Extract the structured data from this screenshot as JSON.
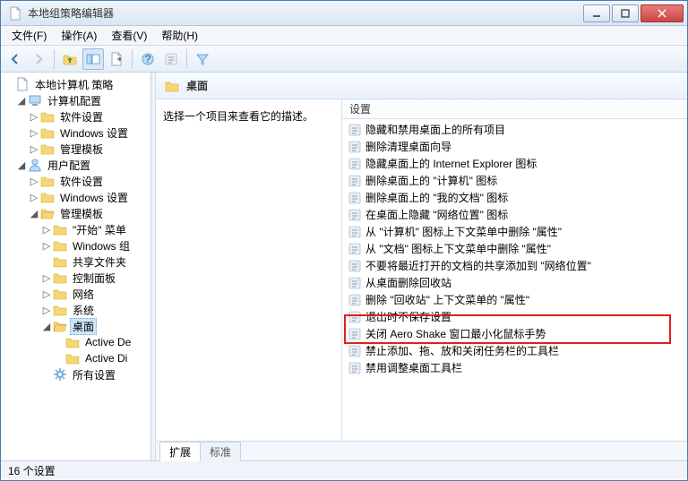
{
  "window": {
    "title": "本地组策略编辑器"
  },
  "menu": {
    "file": "文件(F)",
    "action": "操作(A)",
    "view": "查看(V)",
    "help": "帮助(H)"
  },
  "tree": {
    "root": "本地计算机 策略",
    "computer": "计算机配置",
    "comp_soft": "软件设置",
    "comp_win": "Windows 设置",
    "comp_tmpl": "管理模板",
    "user": "用户配置",
    "user_soft": "软件设置",
    "user_win": "Windows 设置",
    "user_tmpl": "管理模板",
    "start_menu": "\"开始\" 菜单",
    "win_group": "Windows 组",
    "shared": "共享文件夹",
    "control": "控制面板",
    "network": "网络",
    "system": "系统",
    "desktop": "桌面",
    "ad_de": "Active De",
    "ad_di": "Active Di",
    "all_settings": "所有设置"
  },
  "header": {
    "title": "桌面"
  },
  "desc": {
    "prompt": "选择一个项目来查看它的描述。"
  },
  "list": {
    "column": "设置",
    "items": [
      "隐藏和禁用桌面上的所有项目",
      "删除清理桌面向导",
      "隐藏桌面上的 Internet Explorer 图标",
      "删除桌面上的 \"计算机\" 图标",
      "删除桌面上的 \"我的文档\" 图标",
      "在桌面上隐藏 \"网络位置\" 图标",
      "从 \"计算机\" 图标上下文菜单中删除 \"属性\"",
      "从 \"文档\" 图标上下文菜单中删除 \"属性\"",
      "不要将最近打开的文档的共享添加到 \"网络位置\"",
      "从桌面删除回收站",
      "删除 \"回收站\" 上下文菜单的 \"属性\"",
      "退出时不保存设置",
      "关闭 Aero Shake 窗口最小化鼠标手势",
      "禁止添加、拖、放和关闭任务栏的工具栏",
      "禁用调整桌面工具栏"
    ]
  },
  "tabs": {
    "extend": "扩展",
    "standard": "标准"
  },
  "status": {
    "text": "16 个设置"
  },
  "highlight_index": 12
}
